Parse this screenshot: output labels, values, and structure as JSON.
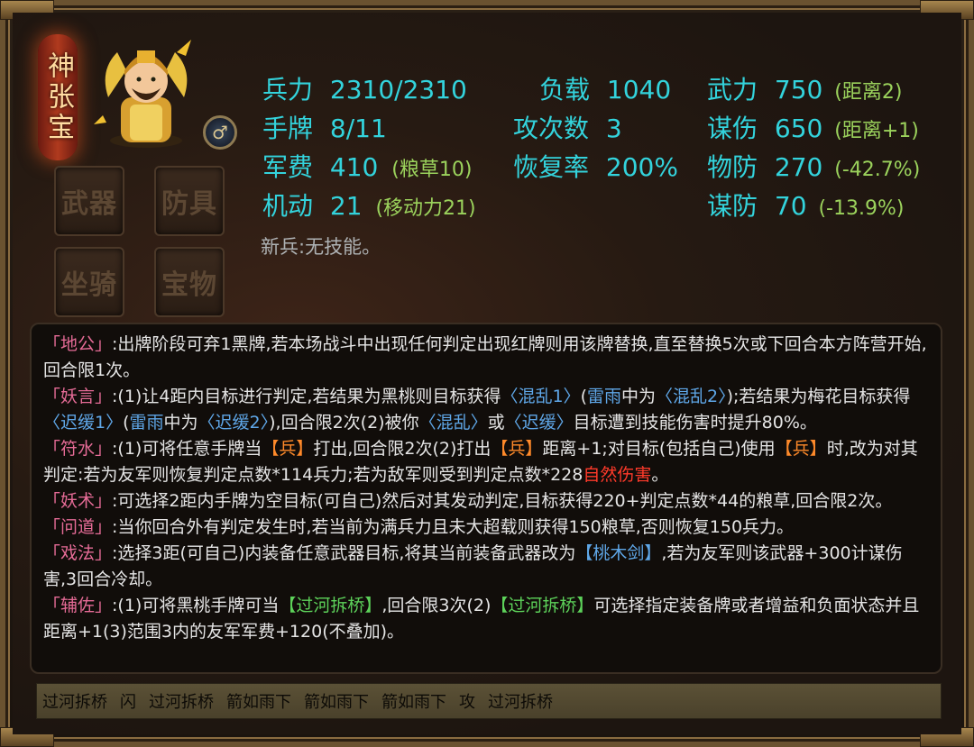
{
  "general": {
    "name": "神张宝"
  },
  "slots": [
    "武器",
    "防具",
    "坐骑",
    "宝物"
  ],
  "stats": {
    "hp_label": "兵力",
    "hp_value": "2310/2310",
    "hand_label": "手牌",
    "hand_value": "8/11",
    "money_label": "军费",
    "money_value": "410",
    "money_note": "(粮草10)",
    "move_label": "机动",
    "move_value": "21",
    "move_note": "(移动力21)",
    "load_label": "负载",
    "load_value": "1040",
    "atk_count_label": "攻次数",
    "atk_count_value": "3",
    "recover_label": "恢复率",
    "recover_value": "200%",
    "force_label": "武力",
    "force_value": "750",
    "force_note": "(距离2)",
    "tactic_label": "谋伤",
    "tactic_value": "650",
    "tactic_note": "(距离+1)",
    "pdef_label": "物防",
    "pdef_value": "270",
    "pdef_note": "(-42.7%)",
    "mdef_label": "谋防",
    "mdef_value": "70",
    "mdef_note": "(-13.9%)"
  },
  "passive": "新兵:无技能。",
  "skills": [
    {
      "name": "「地公」",
      "desc": ":出牌阶段可弃1黑牌,若本场战斗中出现任何判定出现红牌则用该牌替换,直至替换5次或下回合本方阵营开始,回合限1次。"
    },
    {
      "name": "「妖言」",
      "d1": ":(1)让4距内目标进行判定,若结果为黑桃则目标获得",
      "s1": "〈混乱1〉",
      "d2": "(",
      "s2": "雷雨",
      "d3": "中为",
      "s3": "〈混乱2〉",
      "d4": ");若结果为梅花目标获得",
      "s4": "〈迟缓1〉",
      "d5": "(",
      "s5": "雷雨",
      "d6": "中为",
      "s6": "〈迟缓2〉",
      "d7": "),回合限2次(2)被你",
      "s7": "〈混乱〉",
      "d8": "或",
      "s8": "〈迟缓〉",
      "d9": "目标遭到技能伤害时提升80%。"
    },
    {
      "name": "「符水」",
      "d1": ":(1)可将任意手牌当",
      "i1": "【兵】",
      "d2": "打出,回合限2次(2)打出",
      "i2": "【兵】",
      "d3": "距离+1;对目标(包括自己)使用",
      "i3": "【兵】",
      "d4": "时,改为对其判定:若为友军则恢复判定点数*114兵力;若为敌军则受到判定点数*228",
      "dmg": "自然伤害",
      "d5": "。"
    },
    {
      "name": "「妖术」",
      "desc": ":可选择2距内手牌为空目标(可自己)然后对其发动判定,目标获得220+判定点数*44的粮草,回合限2次。"
    },
    {
      "name": "「问道」",
      "desc": ":当你回合外有判定发生时,若当前为满兵力且未大超载则获得150粮草,否则恢复150兵力。"
    },
    {
      "name": "「戏法」",
      "d1": ":选择3距(可自己)内装备任意武器目标,将其当前装备武器改为",
      "s1": "【桃木剑】",
      "d2": ",若为友军则该武器+300计谋伤害,3回合冷却。"
    },
    {
      "name": "「辅佐」",
      "d1": ":(1)可将黑桃手牌可当",
      "g1": "【过河拆桥】",
      "d2": ",回合限3次(2)",
      "g2": "【过河拆桥】",
      "d3": "可选择指定装备牌或者增益和负面状态并且距离+1(3)范围3内的友军军费+120(不叠加)。"
    }
  ],
  "hand_cards": [
    "过河拆桥",
    "闪",
    "过河拆桥",
    "箭如雨下",
    "箭如雨下",
    "箭如雨下",
    "攻",
    "过河拆桥"
  ],
  "colors": {
    "stat": "#33d3dc",
    "note": "#9bd25c",
    "skill_name": "#e56b96",
    "status": "#5fa7e8",
    "item": "#ff8a2a",
    "damage": "#ff3a2a",
    "card": "#5dd25a"
  }
}
